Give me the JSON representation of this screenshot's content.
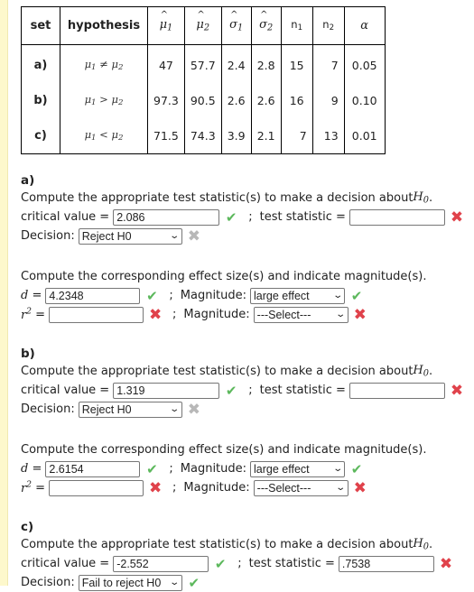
{
  "table": {
    "headers": [
      "set",
      "hypothesis",
      "μ1",
      "μ2",
      "σ1",
      "σ2",
      "n1",
      "n2",
      "α"
    ],
    "rows": [
      {
        "set": "a)",
        "hypothesis": "μ1 ≠ μ2",
        "mu1": "47",
        "mu2": "57.7",
        "s1": "2.4",
        "s2": "2.8",
        "n1": "15",
        "n2": "7",
        "alpha": "0.05"
      },
      {
        "set": "b)",
        "hypothesis": "μ1 > μ2",
        "mu1": "97.3",
        "mu2": "90.5",
        "s1": "2.6",
        "s2": "2.6",
        "n1": "16",
        "n2": "9",
        "alpha": "0.10"
      },
      {
        "set": "c)",
        "hypothesis": "μ1 < μ2",
        "mu1": "71.5",
        "mu2": "74.3",
        "s1": "3.9",
        "s2": "2.1",
        "n1": "7",
        "n2": "13",
        "alpha": "0.01"
      }
    ]
  },
  "labels": {
    "compute_test": "Compute the appropriate test statistic(s) to make a decision about ",
    "h0": "H",
    "h0_sub": "0",
    "critical_value": "critical value =",
    "test_statistic": "test statistic =",
    "decision": "Decision:",
    "compute_effect": "Compute the corresponding effect size(s) and indicate magnitude(s).",
    "d_eq": "d",
    "r2_eq": "r",
    "magnitude": "Magnitude:",
    "semicolon": ";",
    "equals": "="
  },
  "sections": [
    {
      "label": "a)",
      "critical_value": "2.086",
      "critical_status": "correct",
      "test_statistic": "",
      "test_status": "incorrect",
      "decision": "Reject H0",
      "decision_status": "unanswered",
      "d_value": "4.2348",
      "d_status": "correct",
      "d_magnitude": "large effect",
      "d_magnitude_status": "correct",
      "r2_value": "",
      "r2_status": "incorrect",
      "r2_magnitude": "---Select---",
      "r2_magnitude_status": "incorrect"
    },
    {
      "label": "b)",
      "critical_value": "1.319",
      "critical_status": "correct",
      "test_statistic": "",
      "test_status": "incorrect",
      "decision": "Reject H0",
      "decision_status": "unanswered",
      "d_value": "2.6154",
      "d_status": "correct",
      "d_magnitude": "large effect",
      "d_magnitude_status": "correct",
      "r2_value": "",
      "r2_status": "incorrect",
      "r2_magnitude": "---Select---",
      "r2_magnitude_status": "incorrect"
    },
    {
      "label": "c)",
      "critical_value": "-2.552",
      "critical_status": "correct",
      "test_statistic": ".7538",
      "test_status": "incorrect",
      "decision": "Fail to reject H0",
      "decision_status": "partial"
    }
  ],
  "icons": {
    "correct": "✔",
    "incorrect": "✖",
    "unanswered": "✖",
    "chevron": "⌄"
  }
}
